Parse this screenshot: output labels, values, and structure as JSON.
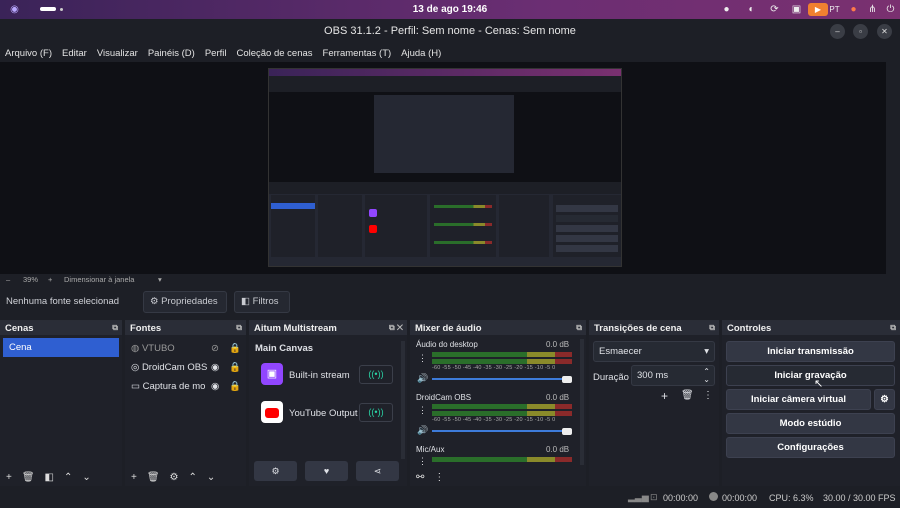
{
  "system": {
    "clock": "13 de ago  19:46",
    "lang": "PT"
  },
  "window": {
    "title": "OBS 31.1.2 - Perfil: Sem nome - Cenas: Sem nome"
  },
  "menu": [
    "Arquivo (F)",
    "Editar",
    "Visualizar",
    "Painéis (D)",
    "Perfil",
    "Coleção de cenas",
    "Ferramentas (T)",
    "Ajuda (H)"
  ],
  "zoom": {
    "value": "39%",
    "mode": "Dimensionar à janela"
  },
  "source_toolbar": {
    "selected": "Nenhuma fonte selecionad",
    "properties": "Propriedades",
    "filters": "Filtros"
  },
  "scenes": {
    "title": "Cenas",
    "items": [
      "Cena"
    ]
  },
  "sources": {
    "title": "Fontes",
    "items": [
      "VTUBO",
      "DroidCam OBS",
      "Captura de mo"
    ]
  },
  "multistream": {
    "title": "Aitum Multistream",
    "canvas": "Main Canvas",
    "outputs": [
      "Built-in stream",
      "YouTube Output"
    ]
  },
  "mixer": {
    "title": "Mixer de áudio",
    "ticks": "-60 -55 -50 -45 -40 -35 -30 -25 -20 -15 -10 -5 0",
    "channels": [
      {
        "name": "Áudio do desktop",
        "db": "0.0 dB",
        "level": 1.0
      },
      {
        "name": "DroidCam OBS",
        "db": "0.0 dB",
        "level": 1.0
      },
      {
        "name": "Mic/Aux",
        "db": "0.0 dB",
        "level": 1.0
      }
    ]
  },
  "transitions": {
    "title": "Transições de cena",
    "type": "Esmaecer",
    "duration_label": "Duração",
    "duration": "300 ms"
  },
  "controls": {
    "title": "Controles",
    "start_stream": "Iniciar transmissão",
    "start_record": "Iniciar gravação",
    "virtual_cam": "Iniciar câmera virtual",
    "studio_mode": "Modo estúdio",
    "settings": "Configurações"
  },
  "status": {
    "rec_time": "00:00:00",
    "stream_time": "00:00:00",
    "cpu": "CPU: 6.3%",
    "fps": "30.00 / 30.00 FPS"
  },
  "colors": {
    "accent": "#2f5fd1",
    "twitch": "#9146ff",
    "youtube": "#ff0000"
  }
}
